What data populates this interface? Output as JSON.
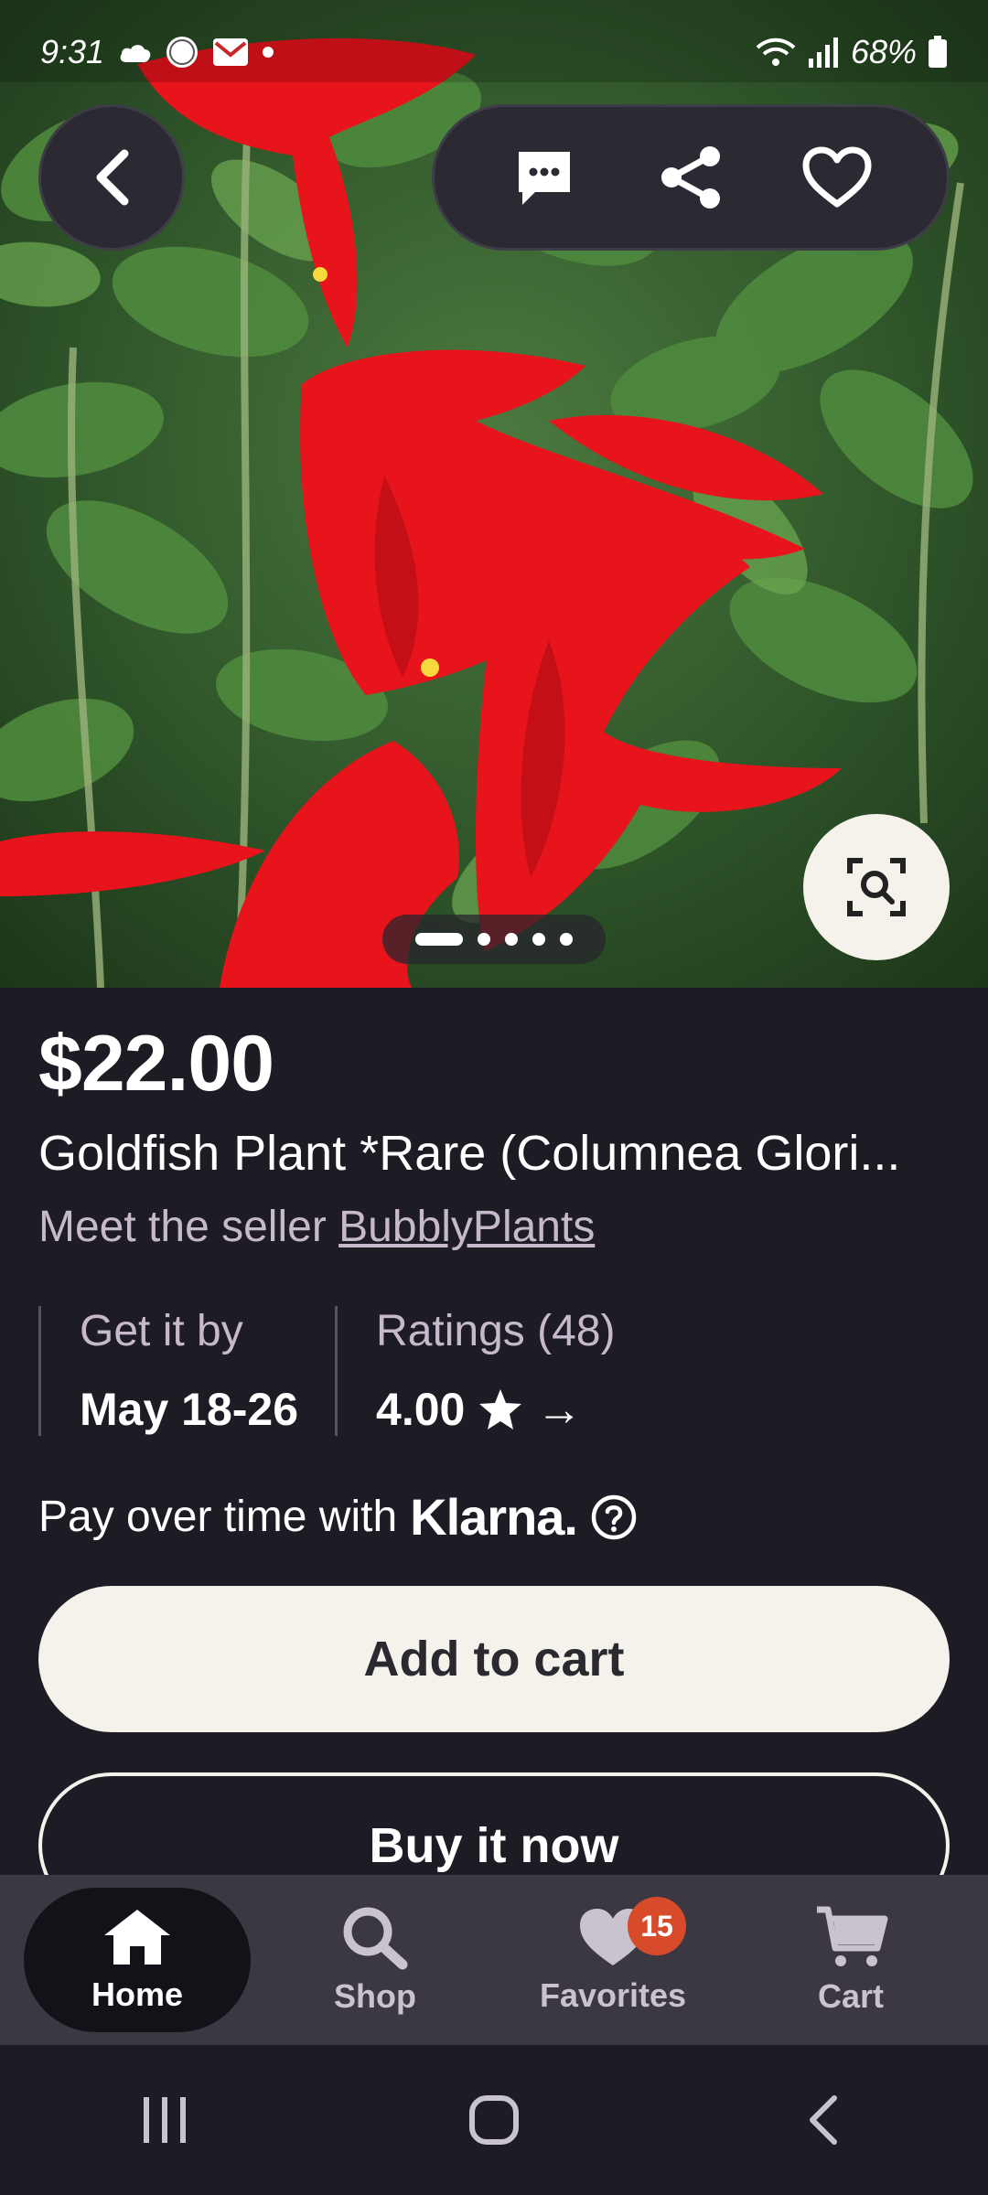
{
  "status_bar": {
    "time": "9:31",
    "battery": "68%"
  },
  "product": {
    "price": "$22.00",
    "title": "Goldfish Plant *Rare (Columnea Glori...",
    "seller_prefix": "Meet the seller",
    "seller_name": "BubblyPlants"
  },
  "delivery": {
    "label": "Get it by",
    "value": "May 18-26"
  },
  "ratings": {
    "label": "Ratings (48)",
    "value": "4.00",
    "arrow": "→"
  },
  "klarna": {
    "text": "Pay over time with",
    "logo": "Klarna."
  },
  "buttons": {
    "add_to_cart": "Add to cart",
    "buy_now": "Buy it now"
  },
  "image_carousel": {
    "total": 5,
    "active_index": 0
  },
  "bottom_nav": {
    "items": [
      {
        "label": "Home",
        "icon": "home-icon",
        "active": true
      },
      {
        "label": "Shop",
        "icon": "search-icon",
        "active": false
      },
      {
        "label": "Favorites",
        "icon": "heart-icon",
        "active": false,
        "badge": "15"
      },
      {
        "label": "Cart",
        "icon": "cart-icon",
        "active": false
      }
    ]
  },
  "colors": {
    "background": "#1d1b24",
    "button_light": "#f5f2ec",
    "badge": "#d74a2a",
    "muted_text": "#c6b9cb"
  }
}
